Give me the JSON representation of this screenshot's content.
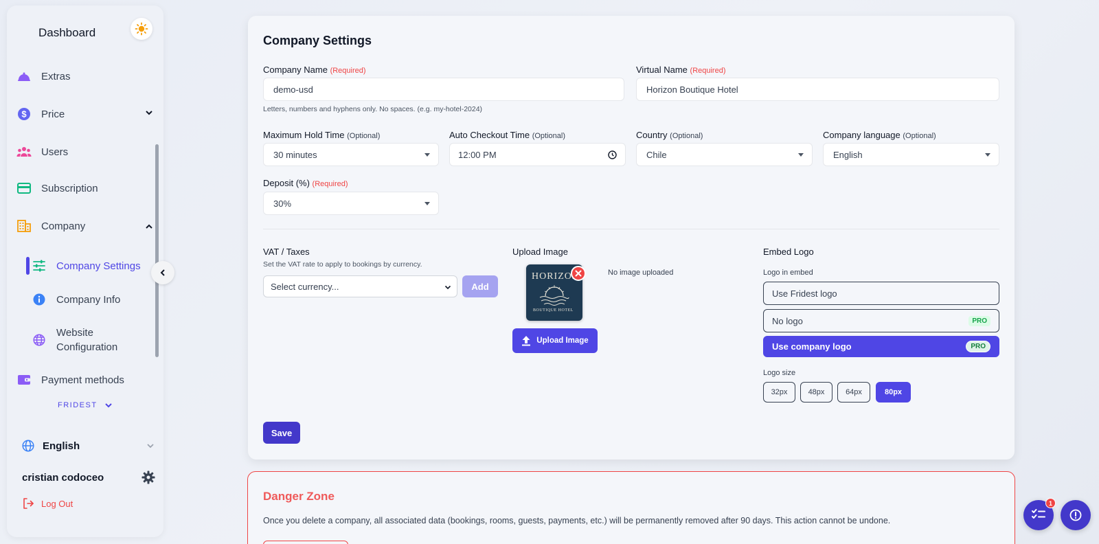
{
  "sidebar": {
    "title": "Dashboard",
    "items": [
      {
        "label": "Extras",
        "icon": "cloche-icon"
      },
      {
        "label": "Price",
        "icon": "dollar-icon"
      },
      {
        "label": "Users",
        "icon": "users-icon"
      },
      {
        "label": "Subscription",
        "icon": "card-icon"
      },
      {
        "label": "Company",
        "icon": "building-icon"
      }
    ],
    "sub_items": [
      {
        "label": "Company Settings",
        "icon": "sliders-icon"
      },
      {
        "label": "Company Info",
        "icon": "info-icon"
      },
      {
        "label": "Website Configuration",
        "icon": "globe-icon"
      }
    ],
    "payment_methods": "Payment methods",
    "workspace": "FRIDEST",
    "language": "English",
    "user_name": "cristian codoceo",
    "logout": "Log Out"
  },
  "settings": {
    "title": "Company Settings",
    "company_name": {
      "label": "Company Name",
      "tag": "(Required)",
      "value": "demo-usd",
      "hint": "Letters, numbers and hyphens only. No spaces. (e.g. my-hotel-2024)"
    },
    "virtual_name": {
      "label": "Virtual Name",
      "tag": "(Required)",
      "value": "Horizon Boutique Hotel"
    },
    "hold_time": {
      "label": "Maximum Hold Time",
      "tag": "(Optional)",
      "value": "30 minutes"
    },
    "checkout_time": {
      "label": "Auto Checkout Time",
      "tag": "(Optional)",
      "value": "12:00 PM"
    },
    "country": {
      "label": "Country",
      "tag": "(Optional)",
      "value": "Chile"
    },
    "company_language": {
      "label": "Company language",
      "tag": "(Optional)",
      "value": "English"
    },
    "deposit": {
      "label": "Deposit (%)",
      "tag": "(Required)",
      "value": "30%"
    },
    "vat": {
      "title": "VAT / Taxes",
      "subtitle": "Set the VAT rate to apply to bookings by currency.",
      "select": "Select currency...",
      "add": "Add"
    },
    "upload": {
      "title": "Upload Image",
      "no_image": "No image uploaded",
      "button": "Upload Image",
      "logo_line1": "HORIZON",
      "logo_line2": "BOUTIQUE HOTEL"
    },
    "embed": {
      "title": "Embed Logo",
      "logo_label": "Logo in embed",
      "options": [
        {
          "label": "Use Fridest logo",
          "badge": ""
        },
        {
          "label": "No logo",
          "badge": "PRO"
        },
        {
          "label": "Use company logo",
          "badge": "PRO"
        }
      ],
      "size_label": "Logo size",
      "sizes": [
        "32px",
        "48px",
        "64px",
        "80px"
      ],
      "selected_size": "80px"
    },
    "save": "Save"
  },
  "danger": {
    "title": "Danger Zone",
    "text": "Once you delete a company, all associated data (bookings, rooms, guests, payments, etc.) will be permanently removed after 90 days. This action cannot be undone."
  },
  "fab": {
    "badge": "1"
  },
  "colors": {
    "accent": "#4f46e5",
    "danger": "#ef4444",
    "pro": "#16a34a"
  }
}
